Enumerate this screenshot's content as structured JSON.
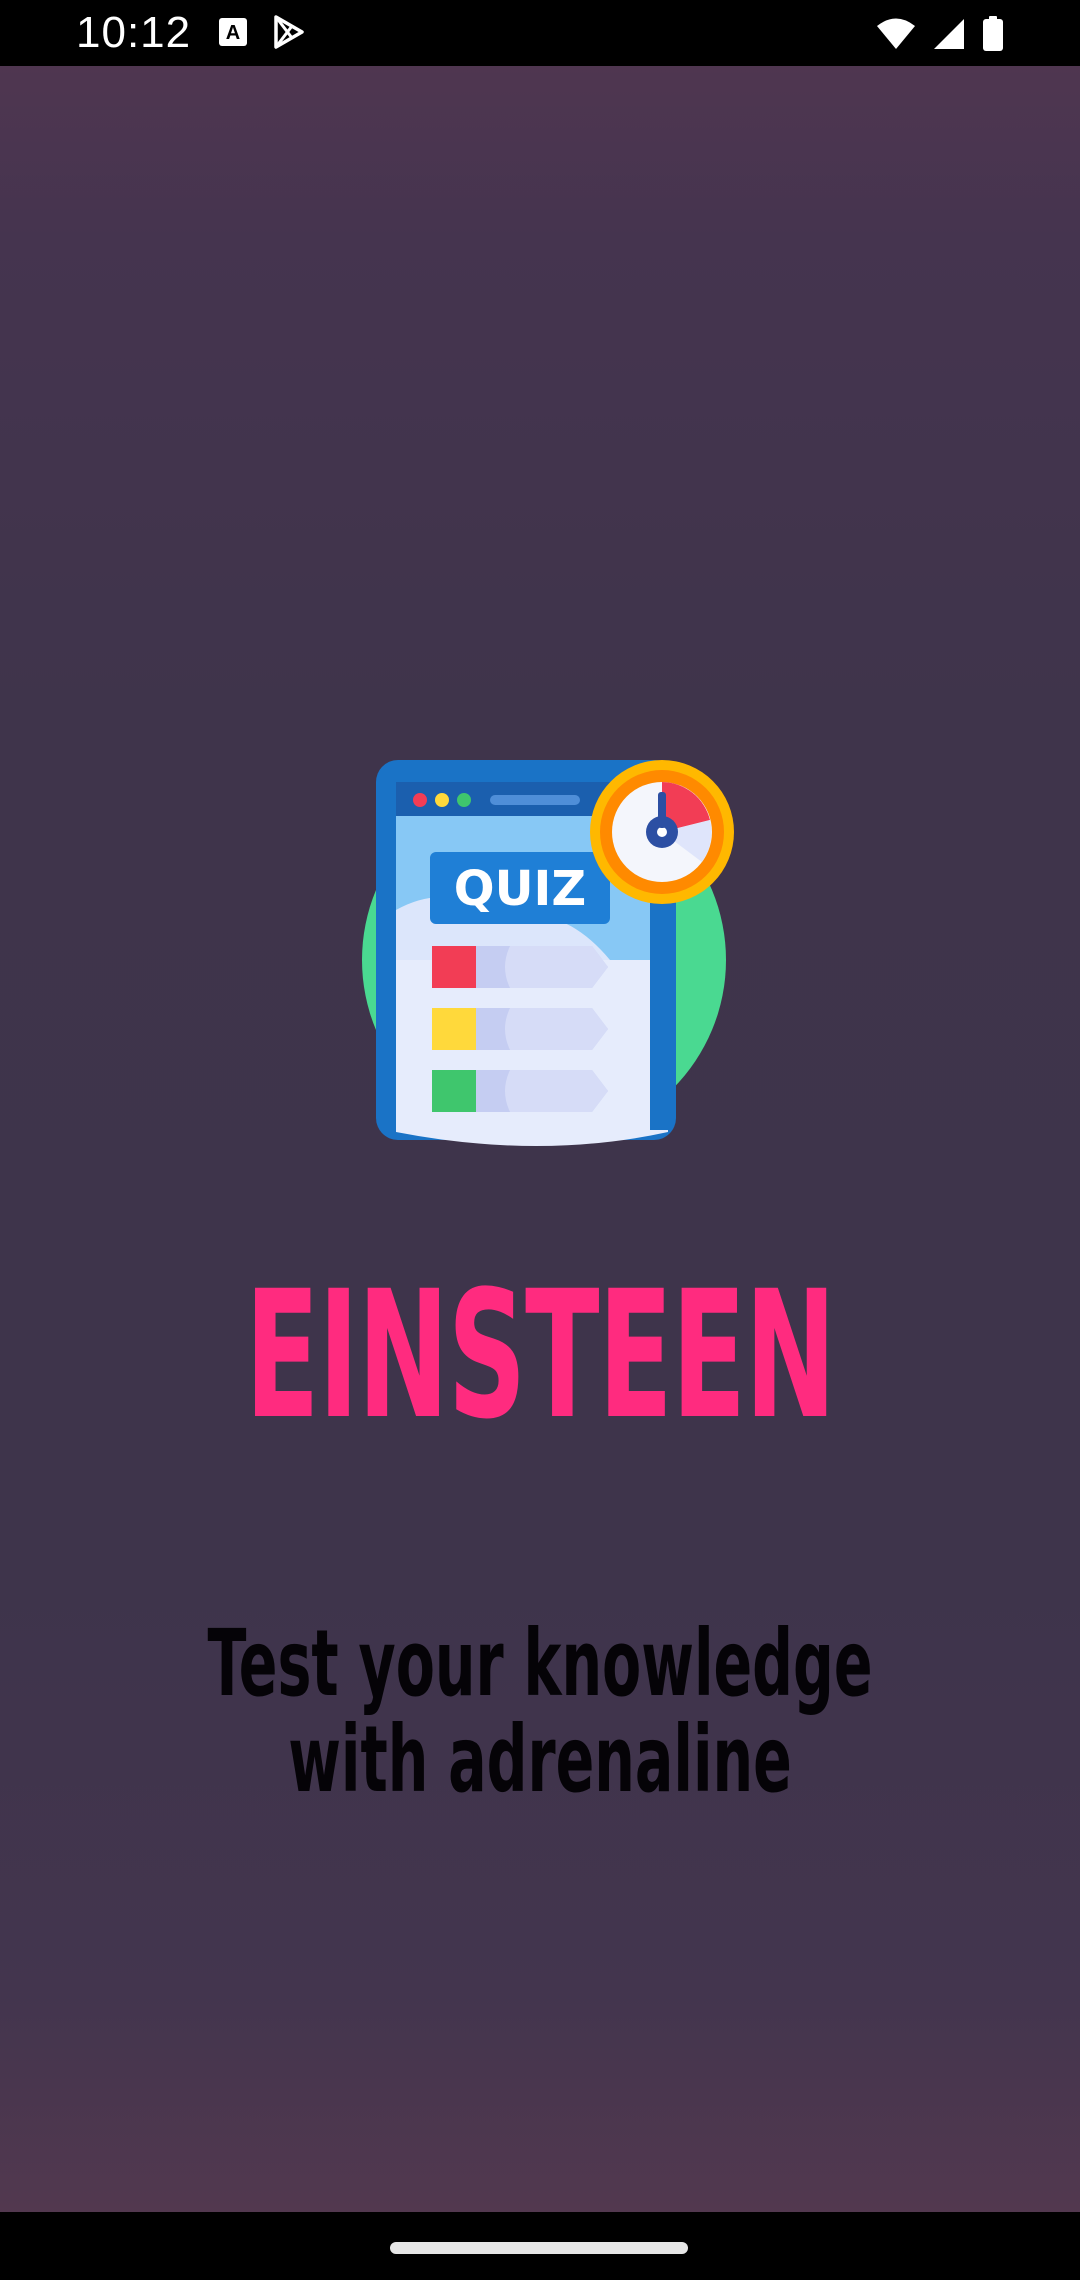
{
  "status_bar": {
    "time": "10:12",
    "left_icons": [
      "translate-icon",
      "play-store-icon"
    ],
    "right_icons": [
      "wifi-icon",
      "cellular-signal-icon",
      "battery-icon"
    ]
  },
  "app": {
    "title": "EINSTEEN",
    "logo_label": "QUIZ",
    "tagline_line1": "Test your knowledge",
    "tagline_line2": "with adrenaline"
  },
  "colors": {
    "title": "#ff2b7f",
    "background": "#3f344b",
    "tagline": "#050307"
  }
}
